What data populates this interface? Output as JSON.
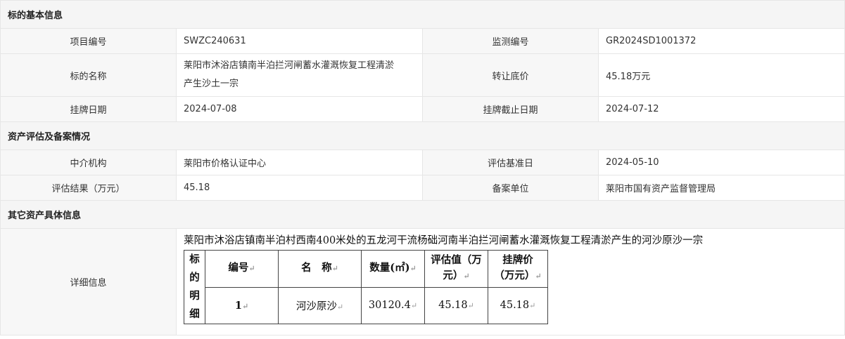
{
  "sections": {
    "basic": {
      "title": "标的基本信息"
    },
    "assessment": {
      "title": "资产评估及备案情况"
    },
    "other": {
      "title": "其它资产具体信息"
    }
  },
  "basic": {
    "project_no_label": "项目编号",
    "project_no": "SWZC240631",
    "monitor_no_label": "监测编号",
    "monitor_no": "GR2024SD1001372",
    "name_label": "标的名称",
    "name_line1": "莱阳市沐浴店镇南半泊拦河闸蓄水灌溉恢复工程清淤",
    "name_line2": "产生沙土一宗",
    "reserve_price_label": "转让底价",
    "reserve_price": "45.18万元",
    "listing_date_label": "挂牌日期",
    "listing_date": "2024-07-08",
    "listing_end_label": "挂牌截止日期",
    "listing_end": "2024-07-12"
  },
  "assessment": {
    "agency_label": "中介机构",
    "agency": "莱阳市价格认证中心",
    "base_date_label": "评估基准日",
    "base_date": "2024-05-10",
    "result_label": "评估结果（万元）",
    "result": "45.18",
    "filing_unit_label": "备案单位",
    "filing_unit": "莱阳市国有资产监督管理局"
  },
  "other": {
    "detail_label": "详细信息",
    "description": "莱阳市沐浴店镇南半泊村西南400米处的五龙河干流杨础河南半泊拦河闸蓄水灌溉恢复工程清淤产生的河沙原沙一宗",
    "table": {
      "row_header_chars": [
        "标",
        "的",
        "明",
        "细"
      ],
      "headers": {
        "no": "编号",
        "name": "名　称",
        "qty": "数量(㎡)",
        "eval_line1": "评估值（万",
        "eval_line2": "元）",
        "price_line1": "挂牌价",
        "price_line2": "（万元）"
      },
      "row": {
        "no": "1",
        "name": "河沙原沙",
        "qty": "30120.4",
        "eval": "45.18",
        "price": "45.18"
      },
      "return_mark": "↵"
    }
  }
}
